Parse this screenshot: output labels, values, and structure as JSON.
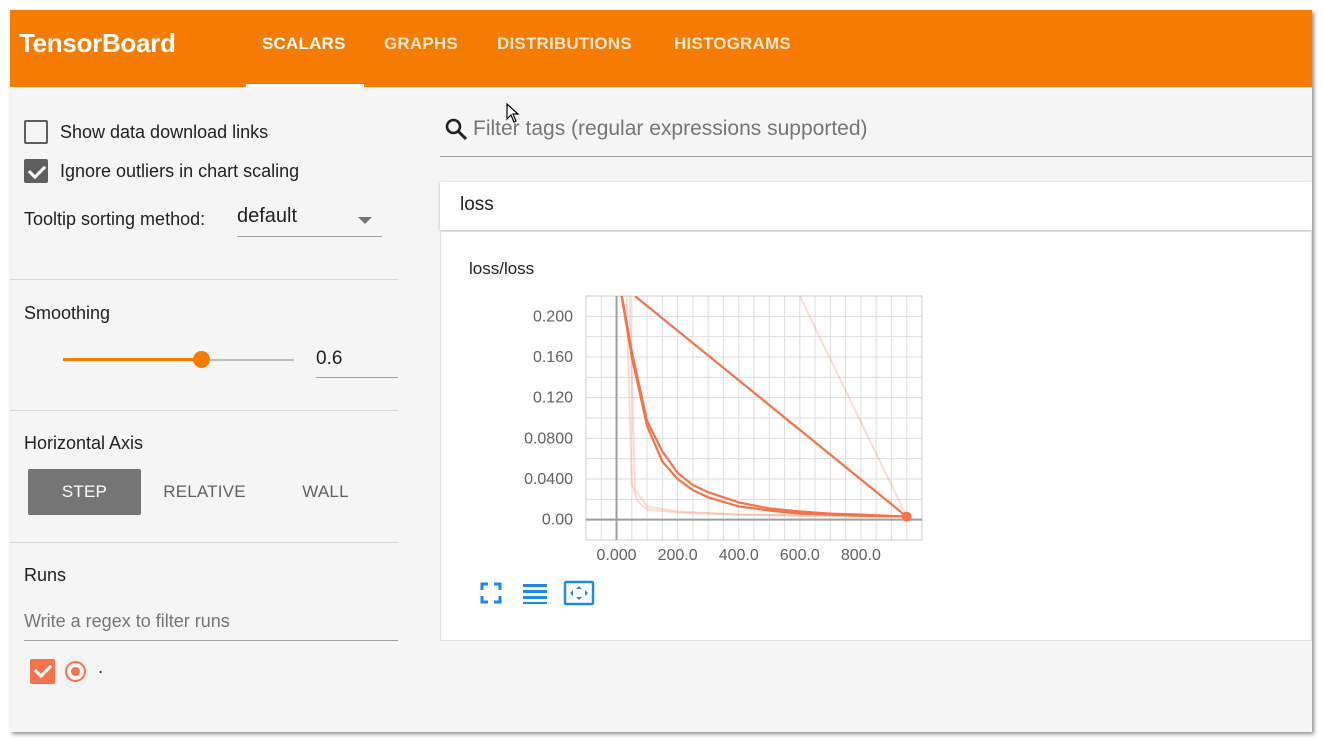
{
  "app": {
    "title": "TensorBoard",
    "accent_color": "#f57c00"
  },
  "tabs": [
    {
      "label": "SCALARS",
      "active": true
    },
    {
      "label": "GRAPHS",
      "active": false
    },
    {
      "label": "DISTRIBUTIONS",
      "active": false
    },
    {
      "label": "HISTOGRAMS",
      "active": false
    }
  ],
  "sidebar": {
    "show_download_links": {
      "label": "Show data download links",
      "checked": false
    },
    "ignore_outliers": {
      "label": "Ignore outliers in chart scaling",
      "checked": true
    },
    "tooltip_sorting": {
      "label": "Tooltip sorting method:",
      "value": "default"
    },
    "smoothing": {
      "title": "Smoothing",
      "value": "0.6",
      "fraction": 0.6
    },
    "horizontal_axis": {
      "title": "Horizontal Axis",
      "options": [
        "STEP",
        "RELATIVE",
        "WALL"
      ],
      "selected": "STEP"
    },
    "runs": {
      "title": "Runs",
      "filter_placeholder": "Write a regex to filter runs",
      "items": [
        {
          "name": ".",
          "checked": true,
          "color": "#f4734a"
        }
      ]
    }
  },
  "main": {
    "filter_placeholder": "Filter tags (regular expressions supported)",
    "group_name": "loss",
    "card": {
      "title": "loss/loss",
      "buttons": [
        "fullscreen-icon",
        "data-table-icon",
        "fit-domain-icon"
      ]
    }
  },
  "chart_data": {
    "type": "line",
    "title": "loss/loss",
    "xlabel": "",
    "ylabel": "",
    "x_ticks": [
      "0.000",
      "200.0",
      "400.0",
      "600.0",
      "800.0"
    ],
    "y_ticks": [
      "0.00",
      "0.0400",
      "0.0800",
      "0.120",
      "0.160",
      "0.200"
    ],
    "xlim": [
      -100,
      1000
    ],
    "ylim": [
      -0.02,
      0.22
    ],
    "grid": true,
    "series_color": "#f4734a",
    "series": [
      {
        "smoothed": true,
        "x": [
          0,
          50,
          100,
          150,
          200,
          250,
          300,
          400,
          500,
          600,
          700,
          800,
          950
        ],
        "y": [
          0.25,
          0.165,
          0.097,
          0.067,
          0.046,
          0.034,
          0.027,
          0.017,
          0.011,
          0.008,
          0.006,
          0.005,
          0.003
        ]
      },
      {
        "smoothed": true,
        "x": [
          0,
          50,
          100,
          150,
          200,
          250,
          300,
          400,
          500,
          600,
          700,
          800,
          950
        ],
        "y": [
          0.25,
          0.16,
          0.092,
          0.057,
          0.04,
          0.029,
          0.022,
          0.013,
          0.009,
          0.006,
          0.005,
          0.004,
          0.003
        ]
      },
      {
        "smoothed": true,
        "x": [
          60,
          950
        ],
        "y": [
          0.22,
          0.003
        ]
      },
      {
        "smoothed": false,
        "x": [
          30,
          50,
          70,
          100,
          200,
          400,
          600,
          950
        ],
        "y": [
          0.25,
          0.035,
          0.018,
          0.01,
          0.007,
          0.005,
          0.004,
          0.003
        ]
      },
      {
        "smoothed": false,
        "x": [
          40,
          60,
          100,
          200,
          400,
          700,
          950
        ],
        "y": [
          0.25,
          0.03,
          0.013,
          0.008,
          0.005,
          0.004,
          0.003
        ]
      },
      {
        "smoothed": false,
        "x": [
          600,
          950
        ],
        "y": [
          0.22,
          0.003
        ]
      }
    ],
    "last_point": {
      "x": 950,
      "y": 0.003
    }
  }
}
